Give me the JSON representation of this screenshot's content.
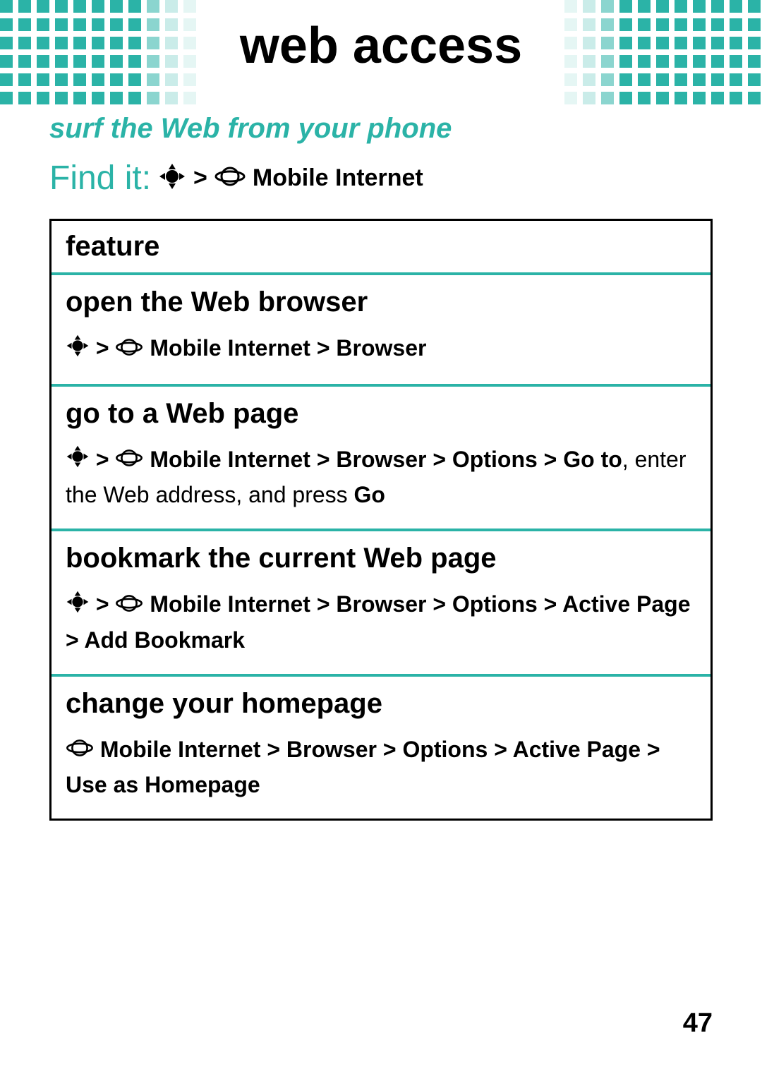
{
  "header": {
    "title": "web access"
  },
  "subtitle": "surf the Web from your phone",
  "findit": {
    "label": "Find it:",
    "gt": ">",
    "target": "Mobile Internet"
  },
  "table": {
    "header": "feature",
    "rows": [
      {
        "title": "open the Web browser",
        "path_bold": "Mobile Internet > Browser",
        "tail_regular": "",
        "tail_bold": "",
        "nav": true
      },
      {
        "title": "go to a Web page",
        "path_bold": "Mobile Internet > Browser > Options > Go to",
        "tail_regular": ", enter the Web address, and press ",
        "tail_bold": "Go",
        "nav": true
      },
      {
        "title": "bookmark the current Web page",
        "path_bold": "Mobile Internet > Browser > Options > Active Page > Add Bookmark",
        "tail_regular": "",
        "tail_bold": "",
        "nav": true
      },
      {
        "title": "change your homepage",
        "path_bold": "Mobile Internet > Browser > Options > Active Page > Use as Homepage",
        "tail_regular": "",
        "tail_bold": "",
        "nav": false
      }
    ]
  },
  "page_number": "47"
}
